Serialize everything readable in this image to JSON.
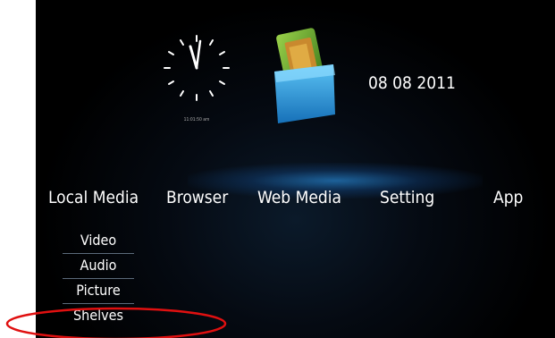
{
  "clock": {
    "time": "11:01:50 am"
  },
  "date": "08 08 2011",
  "main_menu": {
    "items": [
      {
        "label": "Local Media"
      },
      {
        "label": "Browser"
      },
      {
        "label": "Web Media"
      },
      {
        "label": "Setting"
      },
      {
        "label": "App"
      }
    ]
  },
  "submenu": {
    "items": [
      {
        "label": "Video"
      },
      {
        "label": "Audio"
      },
      {
        "label": "Picture"
      },
      {
        "label": "Shelves"
      }
    ]
  },
  "annotation": {
    "color": "#e01010"
  },
  "app_icon": {
    "name": "media-box-icon",
    "colors": {
      "box": "#2a9de0",
      "card": "#6aa832"
    }
  }
}
